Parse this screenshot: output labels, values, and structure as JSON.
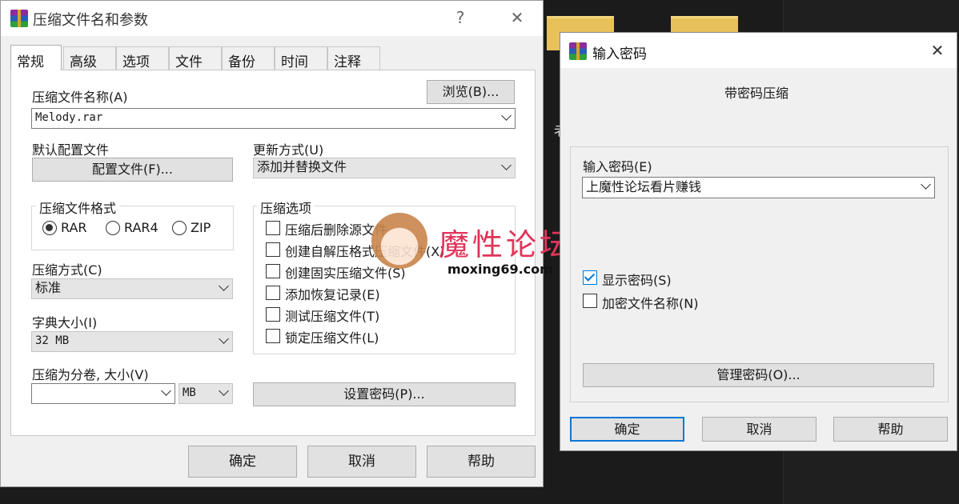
{
  "desktop": {
    "background_char": "老"
  },
  "main_window": {
    "title": "压缩文件名和参数",
    "help_glyph": "?",
    "close_glyph": "✕",
    "tabs": [
      "常规",
      "高级",
      "选项",
      "文件",
      "备份",
      "时间",
      "注释"
    ],
    "archive_name_label": "压缩文件名称(A)",
    "browse_button": "浏览(B)...",
    "archive_name_value": "Melody.rar",
    "default_profile_label": "默认配置文件",
    "profile_button": "配置文件(F)...",
    "update_mode_label": "更新方式(U)",
    "update_mode_value": "添加并替换文件",
    "format_group_title": "压缩文件格式",
    "formats": [
      {
        "label": "RAR",
        "selected": true
      },
      {
        "label": "RAR4",
        "selected": false
      },
      {
        "label": "ZIP",
        "selected": false
      }
    ],
    "options_group_title": "压缩选项",
    "options": [
      {
        "label": "压缩后删除源文件",
        "checked": false
      },
      {
        "label": "创建自解压格式压缩文件(X)",
        "checked": false
      },
      {
        "label": "创建固实压缩文件(S)",
        "checked": false
      },
      {
        "label": "添加恢复记录(E)",
        "checked": false
      },
      {
        "label": "测试压缩文件(T)",
        "checked": false
      },
      {
        "label": "锁定压缩文件(L)",
        "checked": false
      }
    ],
    "method_label": "压缩方式(C)",
    "method_value": "标准",
    "dict_label": "字典大小(I)",
    "dict_value": "32 MB",
    "split_label": "压缩为分卷, 大小(V)",
    "split_value": "",
    "split_unit": "MB",
    "set_password_button": "设置密码(P)...",
    "ok_button": "确定",
    "cancel_button": "取消",
    "help_button": "帮助"
  },
  "password_dialog": {
    "title": "输入密码",
    "close_glyph": "✕",
    "subtitle": "带密码压缩",
    "enter_label": "输入密码(E)",
    "password_value": "上魔性论坛看片赚钱",
    "show_password_label": "显示密码(S)",
    "show_password_checked": true,
    "encrypt_names_label": "加密文件名称(N)",
    "encrypt_names_checked": false,
    "manage_button": "管理密码(O)...",
    "ok_button": "确定",
    "cancel_button": "取消",
    "help_button": "帮助"
  },
  "watermark": {
    "text": "魔性论坛",
    "url": "moxing69.com"
  },
  "colors": {
    "accent": "#0078d7",
    "watermark": "#e0355a"
  }
}
